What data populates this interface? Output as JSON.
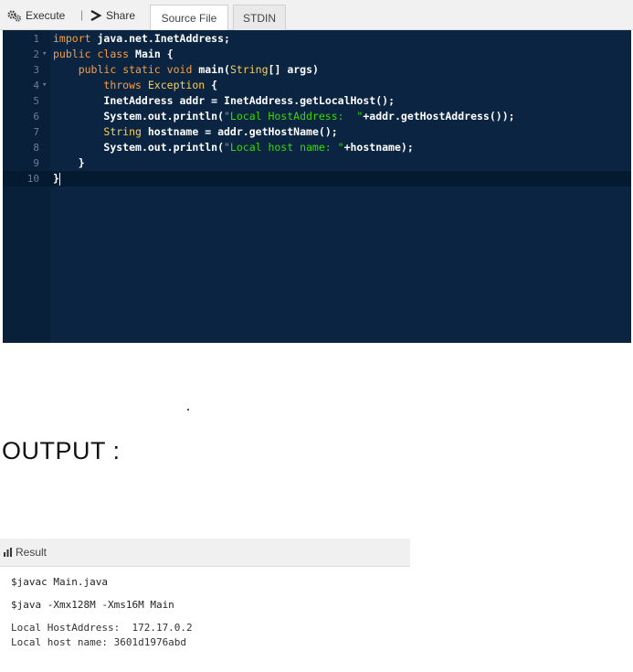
{
  "toolbar": {
    "execute_label": "Execute",
    "separator": "|",
    "share_label": "Share",
    "tabs": [
      "Source File",
      "STDIN"
    ],
    "active_tab": "Source File"
  },
  "editor": {
    "lines": [
      {
        "num": "1",
        "fold": "",
        "code": "import java.net.InetAddress;"
      },
      {
        "num": "2",
        "fold": "▾",
        "code": "public class Main {"
      },
      {
        "num": "3",
        "fold": "",
        "code": "    public static void main(String[] args)"
      },
      {
        "num": "4",
        "fold": "▾",
        "code": "        throws Exception {"
      },
      {
        "num": "5",
        "fold": "",
        "code": "        InetAddress addr = InetAddress.getLocalHost();"
      },
      {
        "num": "6",
        "fold": "",
        "code": "        System.out.println(\"Local HostAddress:  \"+addr.getHostAddress());"
      },
      {
        "num": "7",
        "fold": "",
        "code": "        String hostname = addr.getHostName();"
      },
      {
        "num": "8",
        "fold": "",
        "code": "        System.out.println(\"Local host name: \"+hostname);"
      },
      {
        "num": "9",
        "fold": "",
        "code": "    }"
      },
      {
        "num": "10",
        "fold": "",
        "code": "}"
      }
    ],
    "active_line": 10
  },
  "output_heading": "OUTPUT :",
  "result": {
    "header_label": "Result",
    "lines": [
      "$javac Main.java",
      "$java -Xmx128M -Xms16M Main",
      "Local HostAddress:  172.17.0.2",
      "Local host name: 3601d1976abd"
    ]
  },
  "colors": {
    "editor_bg": "#0a2441",
    "keyword": "#ff9d3b",
    "type": "#ffd04b",
    "string": "#3ad900",
    "plain": "#ffffff"
  },
  "icons": [
    "gears-icon",
    "share-chevron-icon",
    "bar-chart-icon"
  ]
}
